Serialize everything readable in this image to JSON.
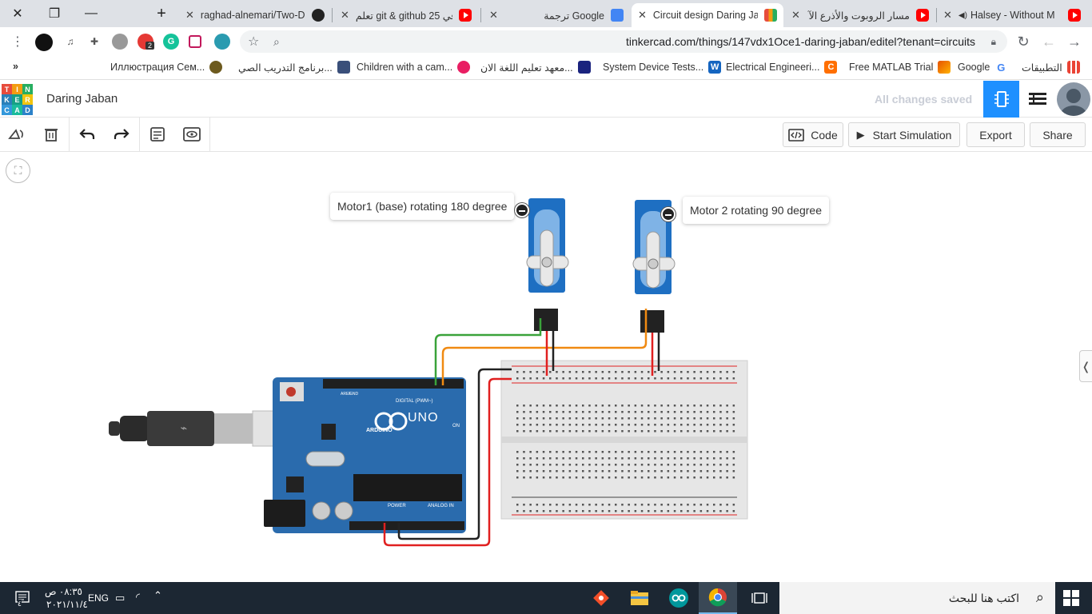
{
  "browser": {
    "tabs": [
      {
        "title": "raghad-alnemari/Two-D",
        "favicon": "github-icon"
      },
      {
        "title": "تعلم git & github في 25",
        "favicon": "youtube-icon"
      },
      {
        "title": "ترجمة Google",
        "favicon": "google-translate-icon"
      },
      {
        "title": "Circuit design Daring Ja",
        "favicon": "tinkercad-icon",
        "active": true
      },
      {
        "title": "مسار الروبوت والأذرع الآ",
        "favicon": "youtube-icon"
      },
      {
        "title": "Halsey - Without M",
        "favicon": "youtube-icon"
      }
    ],
    "url": "tinkercad.com/things/147vdx1Oce1-daring-jaban/editel?tenant=circuits",
    "bookmarks": [
      "التطبيقات",
      "Google",
      "Free MATLAB Trial",
      "Electrical Engineeri...",
      "System Device Tests...",
      "معهد تعليم اللغة الان...",
      "Children with a cam...",
      "برنامج التدريب الصي...",
      "Иллюстрация Сем..."
    ],
    "ext_badge": "2"
  },
  "tinkercad": {
    "logo_letters": [
      "T",
      "I",
      "N",
      "K",
      "E",
      "R",
      "C",
      "A",
      "D"
    ],
    "design_name": "Daring Jaban",
    "save_status": "All changes saved",
    "toolbar": {
      "code_label": "Code",
      "simulate_label": "Start Simulation",
      "export_label": "Export",
      "share_label": "Share"
    },
    "notes": {
      "motor1": "Motor1 (base) rotating 180 degree",
      "motor2": "Motor 2 rotating 90 degree"
    },
    "board": {
      "uno_label": "UNO",
      "brand": "ARDUINO",
      "digital_label": "DIGITAL (PWM~)",
      "power_label": "POWER",
      "analog_label": "ANALOG IN",
      "on_label": "ON",
      "aref_label": "AREF",
      "gnd_label": "GND"
    },
    "wire_colors": {
      "signal1": "#3aa33a",
      "signal2": "#f08a12",
      "power": "#e02020",
      "ground": "#222222"
    }
  },
  "taskbar": {
    "search_placeholder": "اكتب هنا للبحث",
    "time": "٠٨:٣٥ ص",
    "date": "٢٠٢١/١١/٤",
    "lang": "ENG",
    "notif_badge": "٤"
  }
}
